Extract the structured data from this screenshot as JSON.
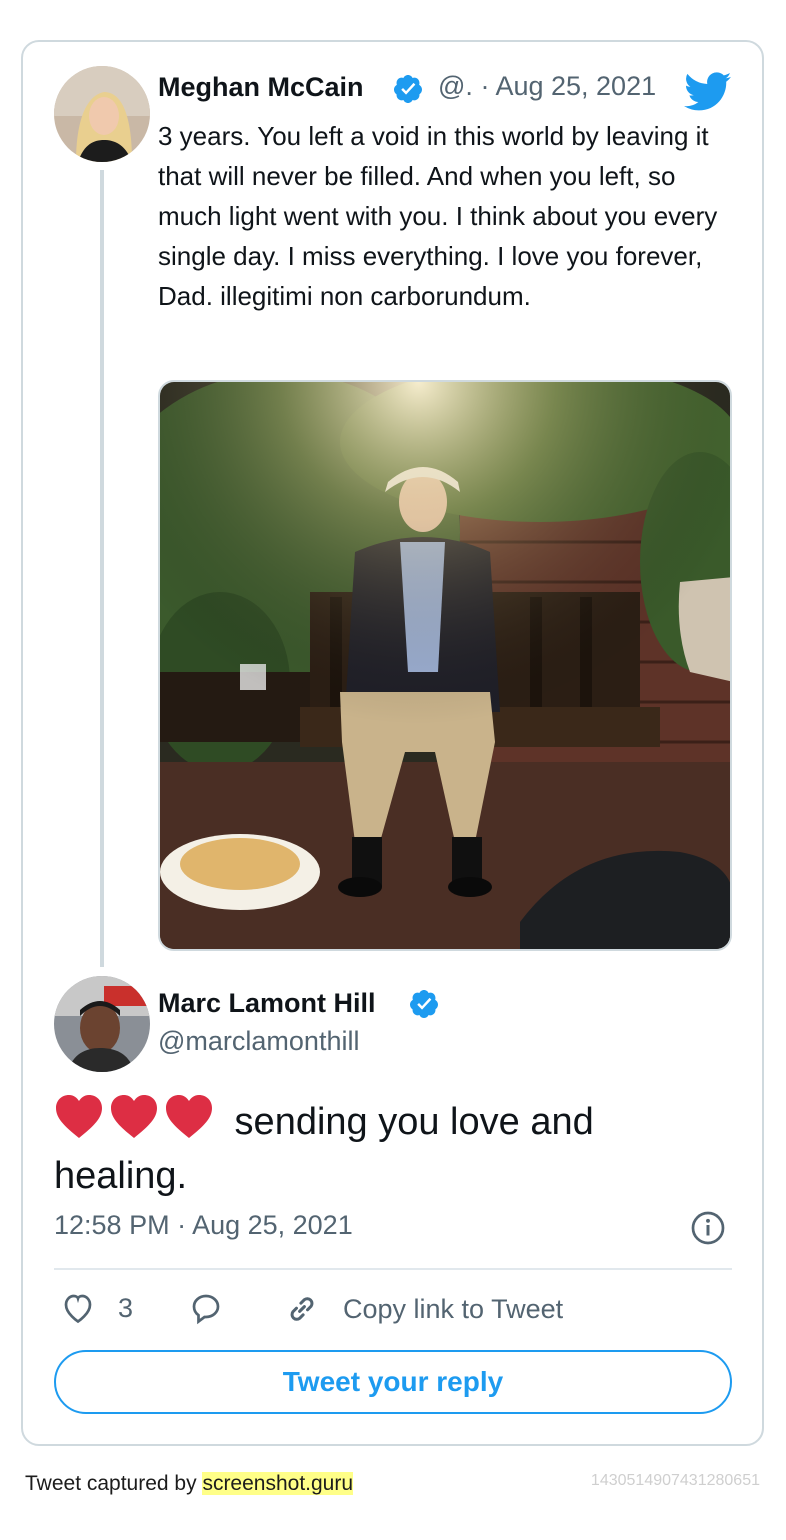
{
  "parent_tweet": {
    "author_name": "Meghan McCain",
    "author_handle": "@.",
    "separator": "·",
    "date": "Aug 25, 2021",
    "text": "3 years. You left a void in this world by leaving it that will never be filled. And when you left, so much light went with you. I think about you every single day. I miss everything. I love you forever, Dad. illegitimi non carborundum."
  },
  "reply_tweet": {
    "author_name": "Marc Lamont Hill",
    "author_handle": "@marclamonthill",
    "hearts": "❤❤❤",
    "text": " sending you love and healing.",
    "timestamp": "12:58 PM · Aug 25, 2021"
  },
  "actions": {
    "like_count": "3",
    "copy_link_label": "Copy link to Tweet",
    "reply_button_label": "Tweet your reply"
  },
  "footer": {
    "captured_by_prefix": "Tweet captured by ",
    "captured_by_site": "screenshot.guru",
    "tweet_id": "1430514907431280651"
  },
  "colors": {
    "accent_blue": "#1d9bf0",
    "heart_red": "#dd2e44",
    "muted_gray": "#536471",
    "border_gray": "#cfd9de"
  },
  "icons": [
    "verified-badge-icon",
    "twitter-bird-icon",
    "info-icon",
    "heart-icon",
    "reply-bubble-icon",
    "link-icon"
  ]
}
